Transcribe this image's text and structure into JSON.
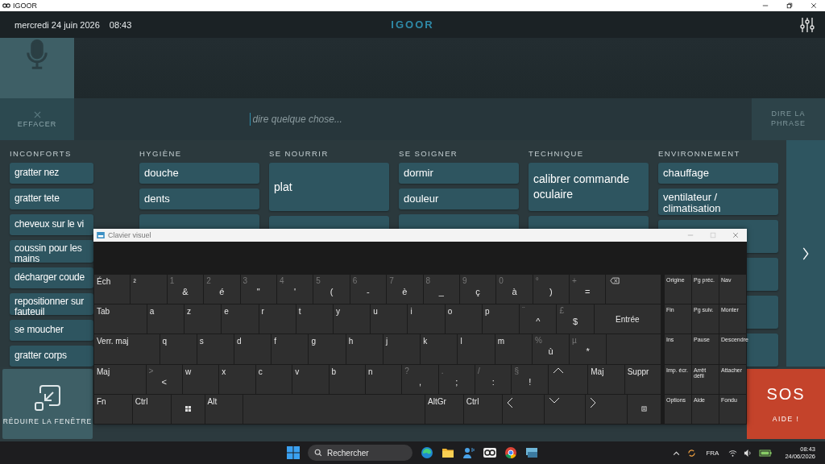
{
  "window": {
    "title": "IGOOR"
  },
  "header": {
    "date": "mercredi 24 juin 2026",
    "time": "08:43",
    "logo": "IGOOR"
  },
  "message": {
    "clear_label": "EFFACER",
    "placeholder": "dire quelque chose...",
    "say_label": "DIRE LA PHRASE",
    "say_disabled": true
  },
  "categories": [
    {
      "title": "INCONFORTS",
      "items": [
        {
          "label": "gratter nez"
        },
        {
          "label": "gratter tete"
        },
        {
          "label": "cheveux sur le vi"
        },
        {
          "label": "coussin pour les mains"
        },
        {
          "label": "décharger coude"
        },
        {
          "label": "repositionner sur fauteuil"
        },
        {
          "label": "se moucher"
        },
        {
          "label": "gratter corps"
        }
      ]
    },
    {
      "title": "HYGIÈNE",
      "items": [
        {
          "label": "douche"
        },
        {
          "label": "dents"
        }
      ]
    },
    {
      "title": "SE NOURRIR",
      "items": [
        {
          "label": "plat",
          "tall": true
        }
      ]
    },
    {
      "title": "SE SOIGNER",
      "items": [
        {
          "label": "dormir"
        },
        {
          "label": "douleur"
        }
      ]
    },
    {
      "title": "TECHNIQUE",
      "items": [
        {
          "label": "calibrer commande oculaire",
          "tall": true
        }
      ]
    },
    {
      "title": "ENVIRONNEMENT",
      "items": [
        {
          "label": "chauffage"
        },
        {
          "label": "ventilateur / climatisation"
        }
      ]
    }
  ],
  "minimize_label": "RÉDUIRE LA FENÊTRE",
  "sos": {
    "title": "SOS",
    "label": "AIDE !"
  },
  "keyboard": {
    "title": "Clavier visuel",
    "rows": [
      [
        {
          "kind": "text",
          "label": "Éch"
        },
        {
          "kind": "text",
          "label": "²"
        },
        {
          "kind": "dual",
          "shift": "1",
          "main": "&"
        },
        {
          "kind": "dual",
          "shift": "2",
          "main": "é"
        },
        {
          "kind": "dual",
          "shift": "3",
          "main": "\""
        },
        {
          "kind": "dual",
          "shift": "4",
          "main": "'"
        },
        {
          "kind": "dual",
          "shift": "5",
          "main": "("
        },
        {
          "kind": "dual",
          "shift": "6",
          "main": "-"
        },
        {
          "kind": "dual",
          "shift": "7",
          "main": "è"
        },
        {
          "kind": "dual",
          "shift": "8",
          "main": "_"
        },
        {
          "kind": "dual",
          "shift": "9",
          "main": "ç"
        },
        {
          "kind": "dual",
          "shift": "0",
          "main": "à"
        },
        {
          "kind": "dual",
          "shift": "°",
          "main": ")"
        },
        {
          "kind": "dual",
          "shift": "+",
          "main": "="
        },
        {
          "kind": "backspace"
        }
      ],
      [
        {
          "kind": "text",
          "label": "Tab"
        },
        {
          "kind": "text",
          "label": "a"
        },
        {
          "kind": "text",
          "label": "z"
        },
        {
          "kind": "text",
          "label": "e"
        },
        {
          "kind": "text",
          "label": "r"
        },
        {
          "kind": "text",
          "label": "t"
        },
        {
          "kind": "text",
          "label": "y"
        },
        {
          "kind": "text",
          "label": "u"
        },
        {
          "kind": "text",
          "label": "i"
        },
        {
          "kind": "text",
          "label": "o"
        },
        {
          "kind": "text",
          "label": "p"
        },
        {
          "kind": "dual",
          "shift": "¨",
          "main": "^"
        },
        {
          "kind": "dual",
          "shift": "£",
          "main": "$"
        },
        {
          "kind": "center",
          "label": "Entrée"
        }
      ],
      [
        {
          "kind": "text",
          "label": "Verr. maj"
        },
        {
          "kind": "text",
          "label": "q"
        },
        {
          "kind": "text",
          "label": "s"
        },
        {
          "kind": "text",
          "label": "d"
        },
        {
          "kind": "text",
          "label": "f"
        },
        {
          "kind": "text",
          "label": "g"
        },
        {
          "kind": "text",
          "label": "h"
        },
        {
          "kind": "text",
          "label": "j"
        },
        {
          "kind": "text",
          "label": "k"
        },
        {
          "kind": "text",
          "label": "l"
        },
        {
          "kind": "text",
          "label": "m"
        },
        {
          "kind": "dual",
          "shift": "%",
          "main": "ù"
        },
        {
          "kind": "dual",
          "shift": "µ",
          "main": "*"
        },
        {
          "kind": "blank"
        }
      ],
      [
        {
          "kind": "text",
          "label": "Maj"
        },
        {
          "kind": "dual",
          "shift": ">",
          "main": "<"
        },
        {
          "kind": "text",
          "label": "w"
        },
        {
          "kind": "text",
          "label": "x"
        },
        {
          "kind": "text",
          "label": "c"
        },
        {
          "kind": "text",
          "label": "v"
        },
        {
          "kind": "text",
          "label": "b"
        },
        {
          "kind": "text",
          "label": "n"
        },
        {
          "kind": "dual",
          "shift": "?",
          "main": ","
        },
        {
          "kind": "dual",
          "shift": ".",
          "main": ";"
        },
        {
          "kind": "dual",
          "shift": "/",
          "main": ":"
        },
        {
          "kind": "dual",
          "shift": "§",
          "main": "!"
        },
        {
          "kind": "up"
        },
        {
          "kind": "text",
          "label": "Maj"
        },
        {
          "kind": "text",
          "label": "Suppr"
        }
      ],
      [
        {
          "kind": "text",
          "label": "Fn"
        },
        {
          "kind": "text",
          "label": "Ctrl"
        },
        {
          "kind": "windows"
        },
        {
          "kind": "text",
          "label": "Alt"
        },
        {
          "kind": "blank"
        },
        {
          "kind": "text",
          "label": "AltGr"
        },
        {
          "kind": "text",
          "label": "Ctrl"
        },
        {
          "kind": "left"
        },
        {
          "kind": "down"
        },
        {
          "kind": "right"
        },
        {
          "kind": "menu"
        }
      ]
    ],
    "side": [
      [
        "Origine",
        "Pg préc.",
        "Nav"
      ],
      [
        "Fin",
        "Pg suiv.",
        "Monter"
      ],
      [
        "Ins",
        "Pause",
        "Descendre"
      ],
      [
        "Imp. écr.",
        "Arrêt défil",
        "Attacher"
      ],
      [
        "Options",
        "Aide",
        "Fondu"
      ]
    ]
  },
  "taskbar": {
    "search_placeholder": "Rechercher",
    "language": "FRA",
    "time": "08:43",
    "date": "24/06/2026"
  }
}
